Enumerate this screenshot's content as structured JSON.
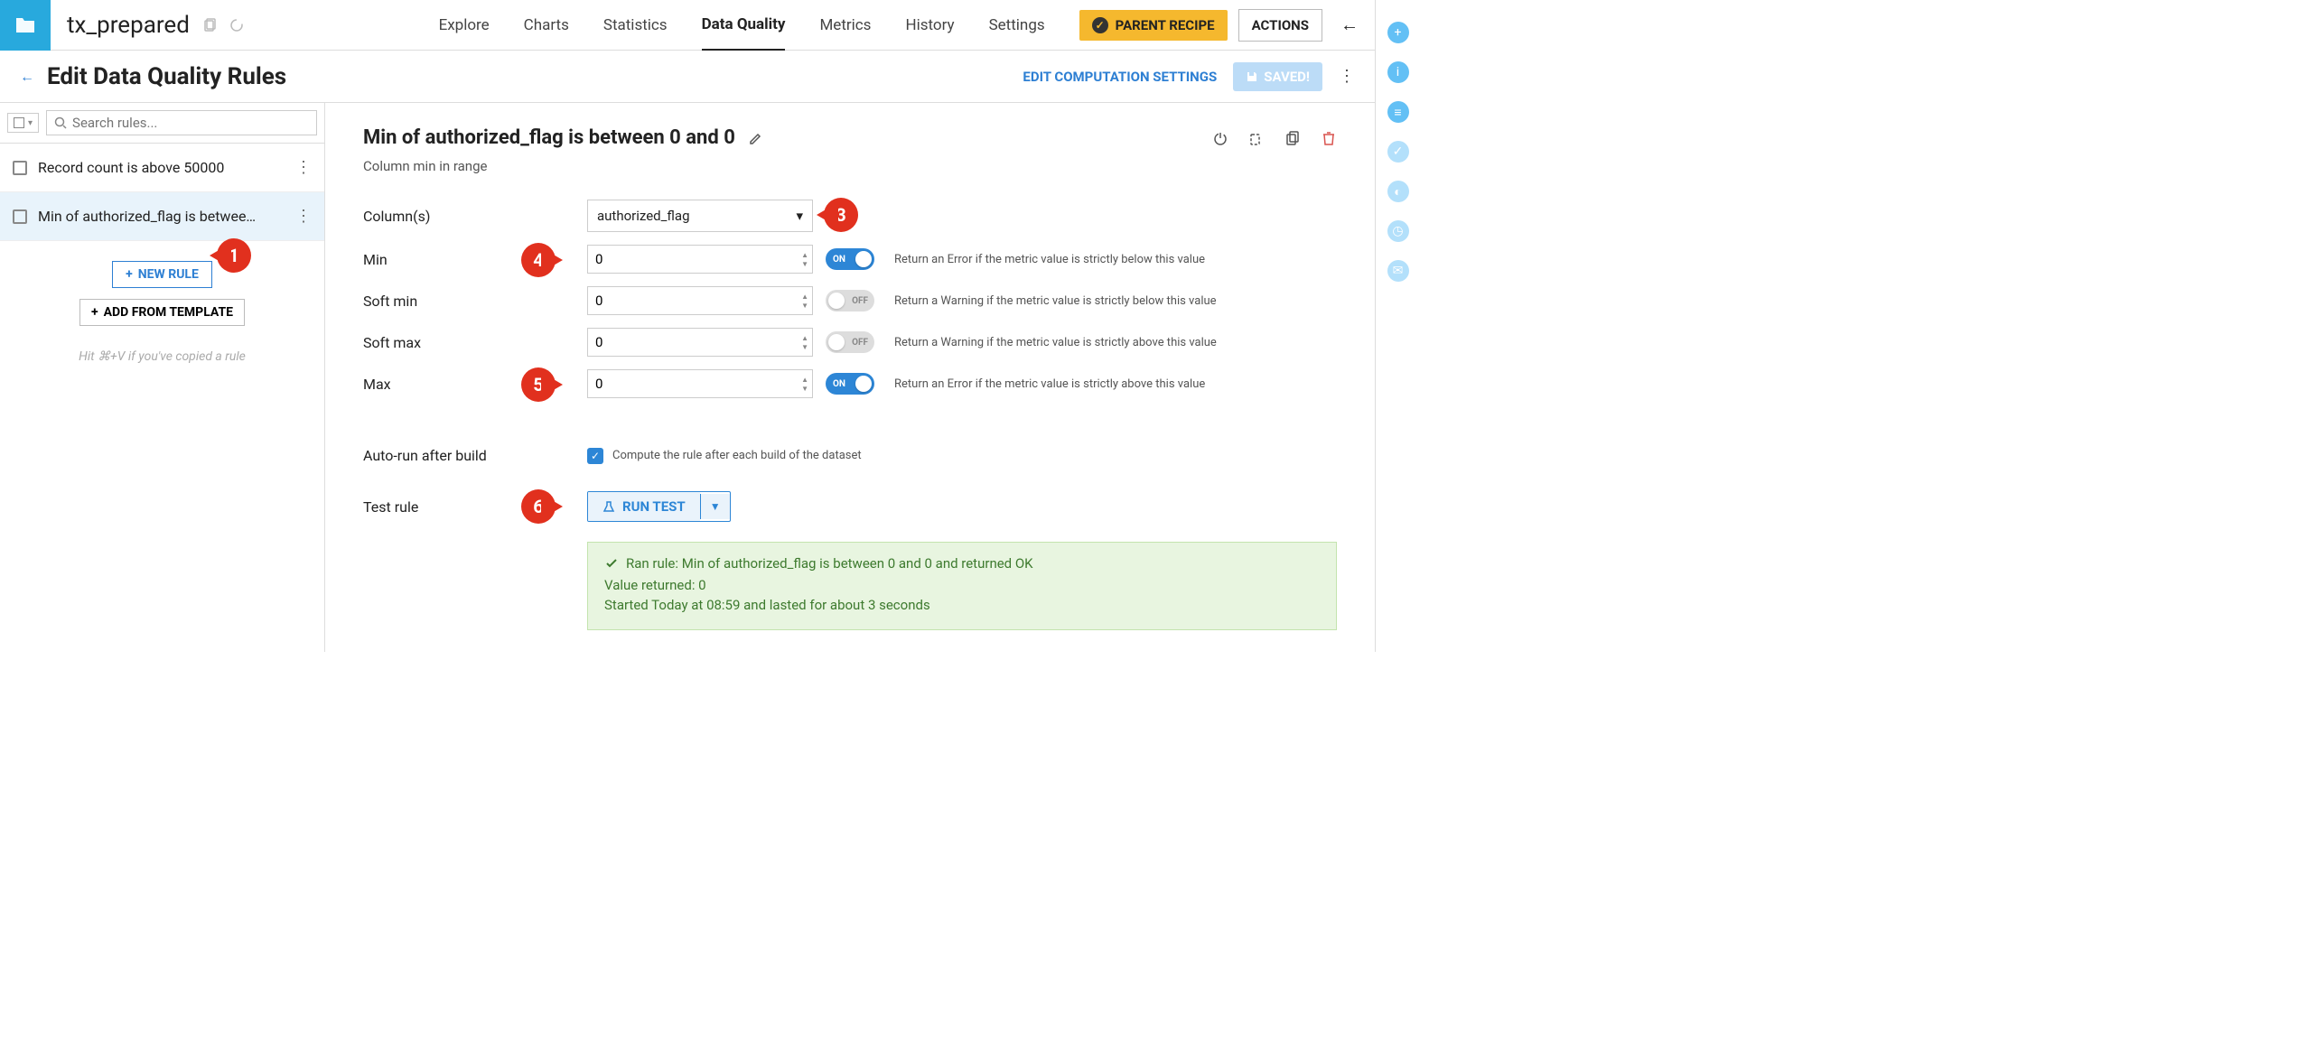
{
  "header": {
    "dataset_name": "tx_prepared",
    "tabs": [
      "Explore",
      "Charts",
      "Statistics",
      "Data Quality",
      "Metrics",
      "History",
      "Settings"
    ],
    "active_tab": "Data Quality",
    "parent_recipe_label": "PARENT RECIPE",
    "actions_label": "ACTIONS"
  },
  "subheader": {
    "title": "Edit Data Quality Rules",
    "edit_comp_label": "EDIT COMPUTATION SETTINGS",
    "saved_label": "SAVED!"
  },
  "sidebar": {
    "search_placeholder": "Search rules...",
    "rules": [
      {
        "label": "Record count is above 50000",
        "selected": false
      },
      {
        "label": "Min of authorized_flag is betwee…",
        "selected": true
      }
    ],
    "new_rule_label": "NEW RULE",
    "add_template_label": "ADD FROM TEMPLATE",
    "paste_hint": "Hit ⌘+V if you've copied a rule"
  },
  "rule": {
    "title": "Min of authorized_flag is between 0 and 0",
    "subtitle": "Column min in range",
    "columns_label": "Column(s)",
    "column_value": "authorized_flag",
    "fields": {
      "min": {
        "label": "Min",
        "value": "0",
        "on": true,
        "onlabel": "ON",
        "help": "Return an Error if the metric value is strictly below this value"
      },
      "softmin": {
        "label": "Soft min",
        "value": "0",
        "on": false,
        "onlabel": "OFF",
        "help": "Return a Warning if the metric value is strictly below this value"
      },
      "softmax": {
        "label": "Soft max",
        "value": "0",
        "on": false,
        "onlabel": "OFF",
        "help": "Return a Warning if the metric value is strictly above this value"
      },
      "max": {
        "label": "Max",
        "value": "0",
        "on": true,
        "onlabel": "ON",
        "help": "Return an Error if the metric value is strictly above this value"
      }
    },
    "autorun_label": "Auto-run after build",
    "autorun_help": "Compute the rule after each build of the dataset",
    "testrule_label": "Test rule",
    "run_test_label": "RUN TEST"
  },
  "result": {
    "line1": "Ran rule: Min of authorized_flag is between 0 and 0 and returned OK",
    "line2": "Value returned: 0",
    "line3": "Started Today at 08:59 and lasted for about 3 seconds"
  },
  "callouts": {
    "c1": "1",
    "c3": "3",
    "c4": "4",
    "c5": "5",
    "c6": "6"
  }
}
